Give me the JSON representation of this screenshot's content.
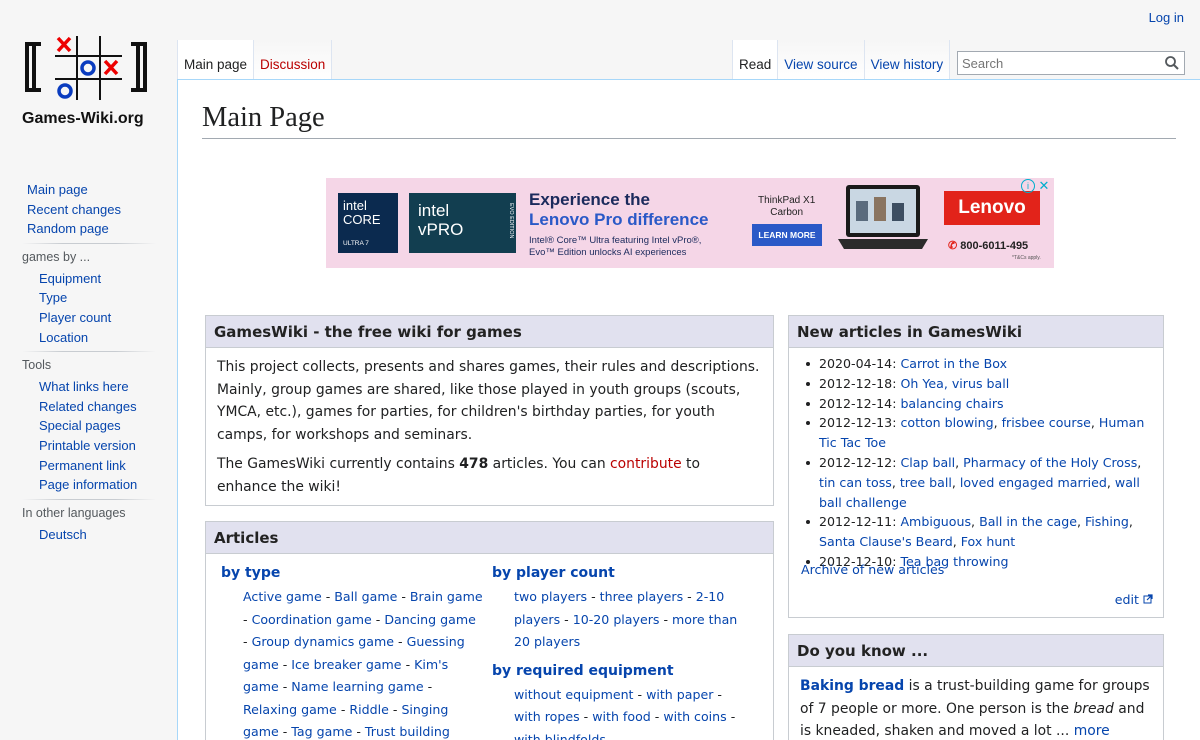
{
  "site": {
    "name": "Games-Wiki.org"
  },
  "login": "Log in",
  "tabs_left": [
    "Main page",
    "Discussion"
  ],
  "tabs_right": [
    "Read",
    "View source",
    "View history"
  ],
  "search": {
    "placeholder": "Search"
  },
  "sidebar": {
    "nav": [
      "Main page",
      "Recent changes",
      "Random page"
    ],
    "games_by": {
      "heading": "games by ...",
      "items": [
        "Equipment",
        "Type",
        "Player count",
        "Location"
      ]
    },
    "tools": {
      "heading": "Tools",
      "items": [
        "What links here",
        "Related changes",
        "Special pages",
        "Printable version",
        "Permanent link",
        "Page information"
      ]
    },
    "languages": {
      "heading": "In other languages",
      "items": [
        "Deutsch"
      ]
    }
  },
  "page_title": "Main Page",
  "ad": {
    "intel_core": "intel CORE",
    "intel_ultra": "ULTRA 7",
    "intel_vpro": "intel vPRO",
    "evo": "EVO EDITION",
    "headline1": "Experience the",
    "headline2": "Lenovo Pro difference",
    "sub1": "Intel® Core™ Ultra featuring Intel vPro®,",
    "sub2": "Evo™ Edition unlocks AI experiences",
    "product1": "ThinkPad X1",
    "product2": "Carbon",
    "cta": "LEARN MORE",
    "brand": "Lenovo",
    "phone": "800-6011-495",
    "fine": "*T&Cs apply."
  },
  "intro": {
    "heading": "GamesWiki - the free wiki for games",
    "p1": "This project collects, presents and shares games, their rules and descriptions. Mainly, group games are shared, like those played in youth groups (scouts, YMCA, etc.), games for parties, for children's birthday parties, for youth camps, for workshops and seminars.",
    "p2_pre": "The GamesWiki currently contains ",
    "count": "478",
    "p2_mid": " articles. You can ",
    "contribute": "contribute",
    "p2_post": " to enhance the wiki!"
  },
  "articles": {
    "heading": "Articles",
    "by_type": {
      "heading": "by type",
      "items": [
        "Active game",
        "Ball game",
        "Brain game",
        "Coordination game",
        "Dancing game",
        "Group dynamics game",
        "Guessing game",
        "Ice breaker game",
        "Kim's game",
        "Name learning game",
        "Relaxing game",
        "Riddle",
        "Singing game",
        "Tag game",
        "Trust building game"
      ]
    },
    "by_player_count": {
      "heading": "by player count",
      "items": [
        "two players",
        "three players",
        "2-10 players",
        "10-20 players",
        "more than 20 players"
      ]
    },
    "by_equipment": {
      "heading": "by required equipment",
      "items": [
        "without equipment",
        "with paper",
        "with ropes",
        "with food",
        "with coins",
        "with blindfolds"
      ]
    }
  },
  "new_articles": {
    "heading": "New articles in GamesWiki",
    "items": [
      {
        "date": "2020-04-14:",
        "links": [
          "Carrot in the Box"
        ]
      },
      {
        "date": "2012-12-18:",
        "links": [
          "Oh Yea, virus ball"
        ]
      },
      {
        "date": "2012-12-14:",
        "links": [
          "balancing chairs"
        ]
      },
      {
        "date": "2012-12-13:",
        "links": [
          "cotton blowing",
          "frisbee course",
          "Human Tic Tac Toe"
        ]
      },
      {
        "date": "2012-12-12:",
        "links": [
          "Clap ball",
          "Pharmacy of the Holy Cross",
          "tin can toss",
          "tree ball",
          "loved engaged married",
          "wall ball challenge"
        ]
      },
      {
        "date": "2012-12-11:",
        "links": [
          "Ambiguous",
          "Ball in the cage",
          "Fishing",
          "Santa Clause's Beard",
          "Fox hunt"
        ]
      },
      {
        "date": "2012-12-10:",
        "links": [
          "Tea bag throwing"
        ]
      }
    ],
    "archive": "Archive of new articles",
    "edit": "edit"
  },
  "do_you_know": {
    "heading": "Do you know ...",
    "title_link": "Baking bread",
    "t1": " is a trust-building game for groups of 7 people or more. One person is the ",
    "em": "bread",
    "t2": " and is kneaded, shaken and moved a lot ... ",
    "more": "more"
  }
}
